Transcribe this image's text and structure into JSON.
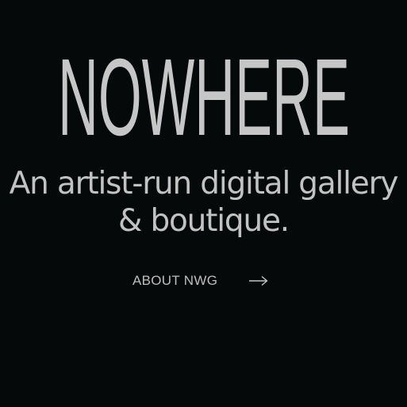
{
  "brand": {
    "logo_text": "NOWHERE"
  },
  "hero": {
    "tagline_line1": "An artist-run digital gallery",
    "tagline_line2": "& boutique."
  },
  "cta": {
    "label": "ABOUT NWG",
    "icon": "arrow-right-icon"
  },
  "colors": {
    "background": "#050909",
    "text": "#c4c4c4"
  }
}
